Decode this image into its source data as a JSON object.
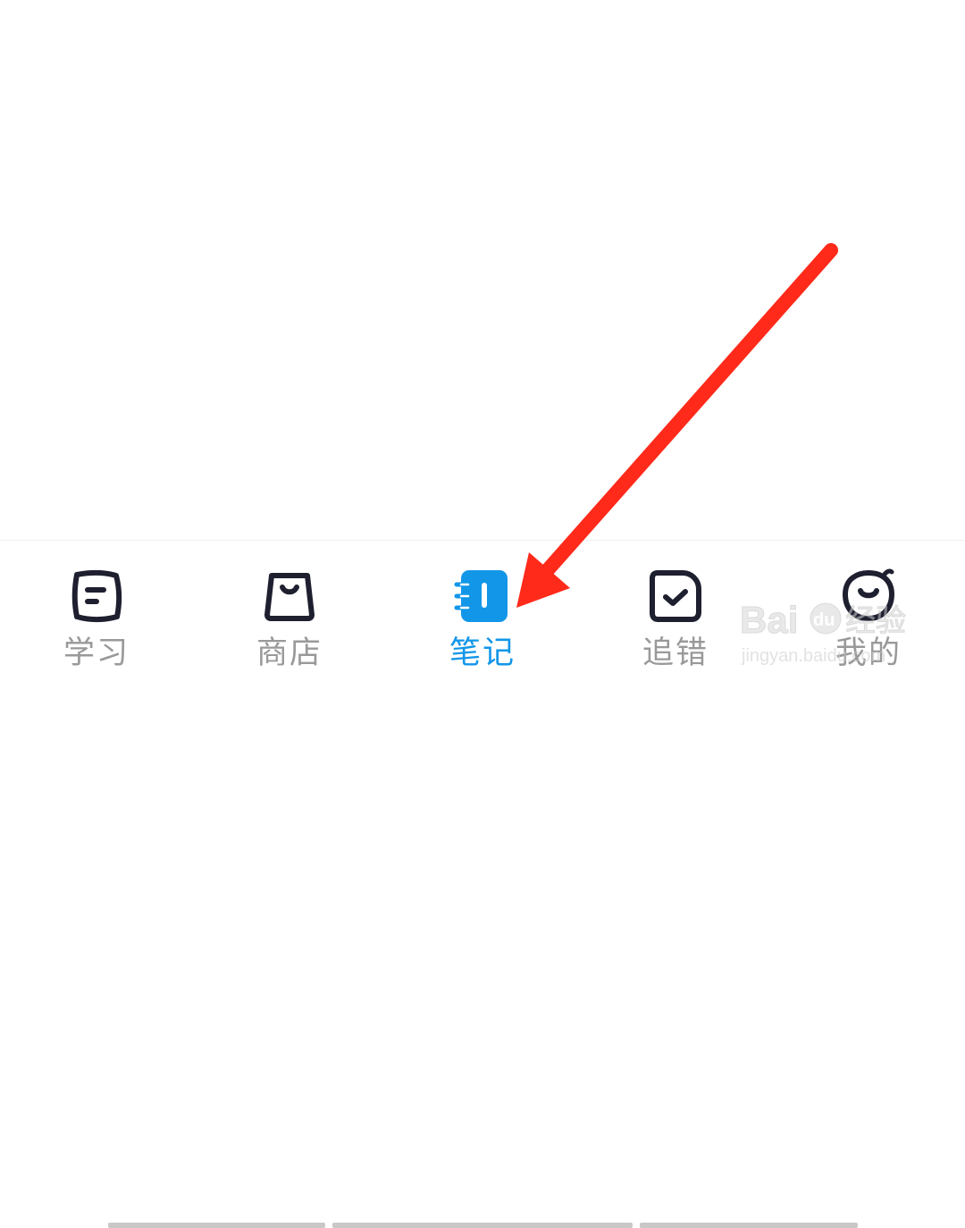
{
  "tabs": [
    {
      "key": "study",
      "label": "学习",
      "icon": "note-card-icon",
      "active": false
    },
    {
      "key": "store",
      "label": "商店",
      "icon": "shopping-bag-icon",
      "active": false
    },
    {
      "key": "notes",
      "label": "笔记",
      "icon": "notebook-icon",
      "active": true
    },
    {
      "key": "mistakes",
      "label": "追错",
      "icon": "check-square-icon",
      "active": false
    },
    {
      "key": "profile",
      "label": "我的",
      "icon": "smiley-face-icon",
      "active": false
    }
  ],
  "colors": {
    "active": "#1296e8",
    "inactive_label": "#999999",
    "icon_stroke": "#1e2030",
    "arrow": "#ff2a1a"
  },
  "watermark": {
    "brand": "Bai",
    "brand_suffix": "du",
    "product": "经验",
    "domain": "jingyan.baidu.com"
  }
}
